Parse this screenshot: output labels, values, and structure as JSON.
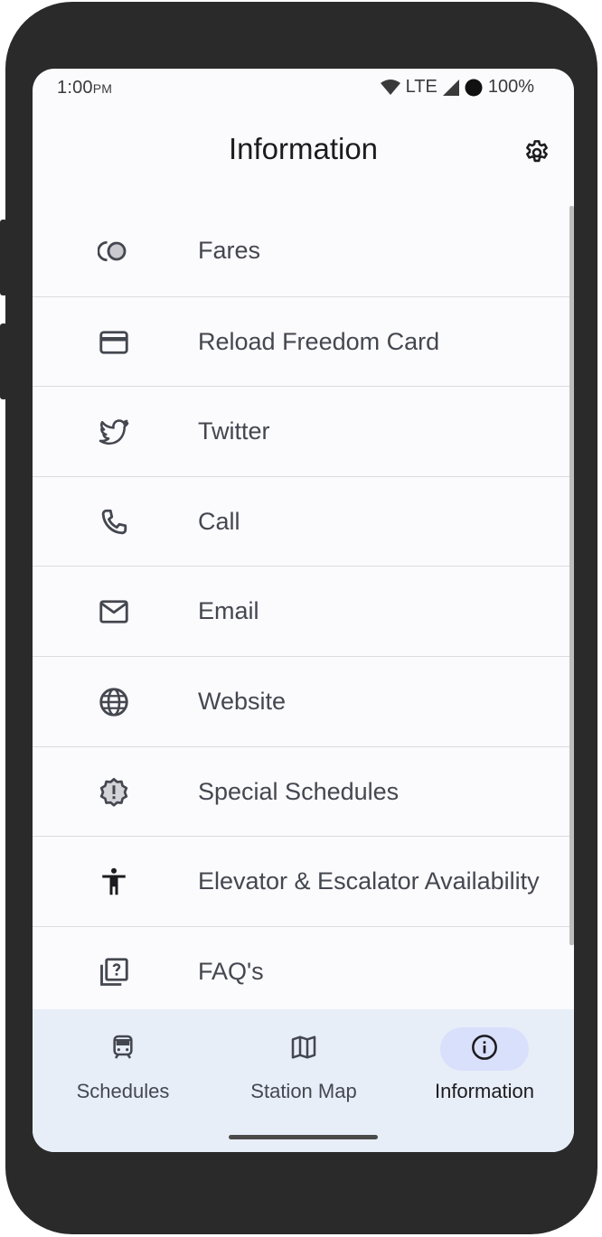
{
  "status": {
    "time": "1:00",
    "ampm": "PM",
    "network": "LTE",
    "battery": "100%"
  },
  "appbar": {
    "title": "Information",
    "settings_icon": "gear-icon"
  },
  "menu": [
    {
      "label": "Fares",
      "icon": "coins-icon"
    },
    {
      "label": "Reload Freedom Card",
      "icon": "credit-card-icon"
    },
    {
      "label": "Twitter",
      "icon": "twitter-bird-icon"
    },
    {
      "label": "Call",
      "icon": "phone-icon"
    },
    {
      "label": "Email",
      "icon": "mail-icon"
    },
    {
      "label": "Website",
      "icon": "globe-icon"
    },
    {
      "label": "Special Schedules",
      "icon": "alert-badge-icon"
    },
    {
      "label": "Elevator & Escalator Availability",
      "icon": "accessibility-icon"
    },
    {
      "label": "FAQ's",
      "icon": "help-library-icon"
    }
  ],
  "nav": [
    {
      "label": "Schedules",
      "icon": "train-icon",
      "active": false
    },
    {
      "label": "Station Map",
      "icon": "map-icon",
      "active": false
    },
    {
      "label": "Information",
      "icon": "info-icon",
      "active": true
    }
  ],
  "colors": {
    "frame": "#2a2a2a",
    "surface": "#fbfafd",
    "nav_bg": "#e8eef8",
    "active_pill": "#d9e0fb",
    "text": "#44474f",
    "divider": "#dcdce0"
  }
}
